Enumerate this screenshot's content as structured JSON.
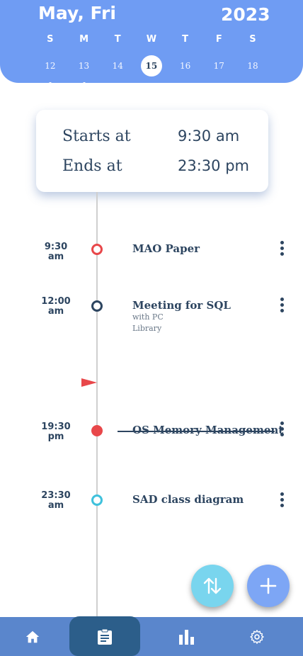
{
  "header": {
    "month": "May, Fri",
    "year": "2023",
    "days": [
      {
        "letter": "S",
        "date": "12",
        "dot": true
      },
      {
        "letter": "M",
        "date": "13",
        "dot": true
      },
      {
        "letter": "T",
        "date": "14",
        "dot": false
      },
      {
        "letter": "W",
        "date": "15",
        "dot": false,
        "selected": true
      },
      {
        "letter": "T",
        "date": "16",
        "dot": false
      },
      {
        "letter": "F",
        "date": "17",
        "dot": false
      },
      {
        "letter": "S",
        "date": "18",
        "dot": false
      }
    ]
  },
  "card": {
    "start_label": "Starts at",
    "start_value": "9:30 am",
    "end_label": "Ends at",
    "end_value": "23:30 pm"
  },
  "events": [
    {
      "time": "9:30",
      "period": "am",
      "title": "MAO Paper",
      "status_color": "#e8474a"
    },
    {
      "time": "12:00",
      "period": "am",
      "title": "Meeting for SQL",
      "sub1": "with PC",
      "sub2": "Library",
      "status_color": "#2d4560"
    },
    {
      "time": "19:30",
      "period": "pm",
      "title": "OS Memory Management",
      "done": true,
      "status_color": "#e8474a"
    },
    {
      "time": "23:30",
      "period": "am",
      "title": "SAD class diagram",
      "status_color": "#3fc1dc"
    }
  ],
  "icons": {
    "flag": "flag-icon",
    "sort": "sort-icon",
    "add": "plus-icon",
    "nav": [
      "home-icon",
      "clipboard-icon",
      "bar-chart-icon",
      "gear-icon"
    ]
  },
  "colors": {
    "header": "#6f9cf3",
    "accent_dark": "#2d4560",
    "nav_bar": "#5a86cc",
    "nav_active": "#2c5e8a"
  }
}
